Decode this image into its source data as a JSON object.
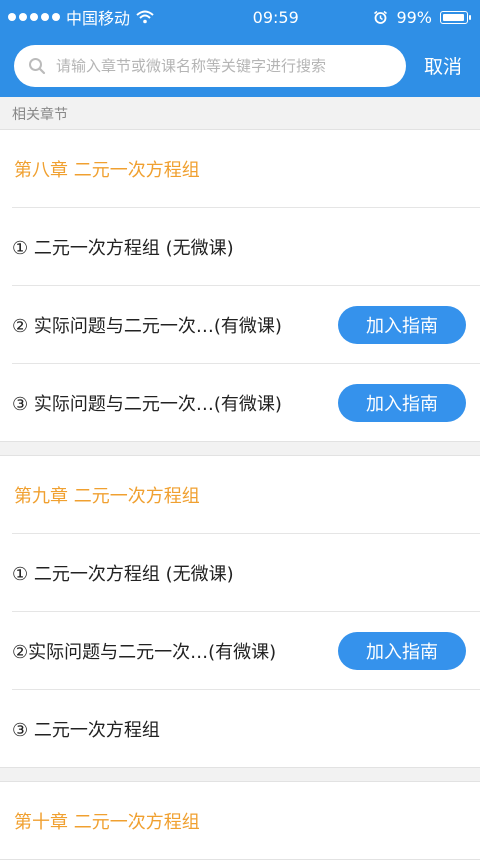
{
  "status": {
    "carrier": "中国移动",
    "time": "09:59",
    "battery": "99%"
  },
  "search": {
    "placeholder": "请输入章节或微课名称等关键字进行搜索",
    "cancel": "取消"
  },
  "section_label": "相关章节",
  "chapters": [
    {
      "title": "第八章   二元一次方程组",
      "items": [
        {
          "text": "① 二元一次方程组 (无微课)"
        },
        {
          "text": "② 实际问题与二元一次…(有微课)",
          "button": "加入指南"
        },
        {
          "text": "③ 实际问题与二元一次…(有微课)",
          "button": "加入指南"
        }
      ]
    },
    {
      "title": "第九章   二元一次方程组",
      "items": [
        {
          "text": "① 二元一次方程组 (无微课)"
        },
        {
          "text": "②实际问题与二元一次…(有微课)",
          "button": "加入指南"
        },
        {
          "text": "③ 二元一次方程组"
        }
      ]
    },
    {
      "title": "第十章   二元一次方程组"
    }
  ]
}
